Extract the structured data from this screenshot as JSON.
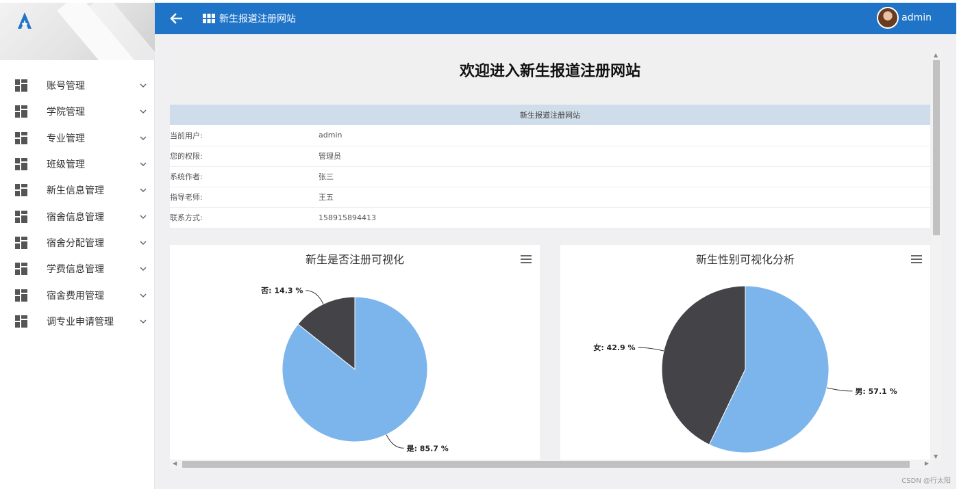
{
  "topbar": {
    "title": "新生报道注册网站",
    "username": "admin"
  },
  "sidebar": {
    "items": [
      {
        "label": "账号管理"
      },
      {
        "label": "学院管理"
      },
      {
        "label": "专业管理"
      },
      {
        "label": "班级管理"
      },
      {
        "label": "新生信息管理"
      },
      {
        "label": "宿舍信息管理"
      },
      {
        "label": "宿舍分配管理"
      },
      {
        "label": "学费信息管理"
      },
      {
        "label": "宿舍费用管理"
      },
      {
        "label": "调专业申请管理"
      }
    ]
  },
  "main": {
    "welcome": "欢迎进入新生报道注册网站",
    "table_header": "新生报道注册网站",
    "rows": [
      {
        "key": "当前用户:",
        "value": "admin"
      },
      {
        "key": "您的权限:",
        "value": "管理员"
      },
      {
        "key": "系统作者:",
        "value": "张三"
      },
      {
        "key": "指导老师:",
        "value": "王五"
      },
      {
        "key": "联系方式:",
        "value": "158915894413"
      }
    ]
  },
  "watermark": "CSDN @行太阳",
  "colors": {
    "topbar": "#1f74c8",
    "slice_light": "#7cb5ec",
    "slice_dark": "#434348"
  },
  "chart_data": [
    {
      "type": "pie",
      "title": "新生是否注册可视化",
      "slices": [
        {
          "label": "是",
          "value": 85.7,
          "color": "#7cb5ec"
        },
        {
          "label": "否",
          "value": 14.3,
          "color": "#434348"
        }
      ]
    },
    {
      "type": "pie",
      "title": "新生性别可视化分析",
      "slices": [
        {
          "label": "男",
          "value": 57.1,
          "color": "#7cb5ec"
        },
        {
          "label": "女",
          "value": 42.9,
          "color": "#434348"
        }
      ]
    }
  ]
}
